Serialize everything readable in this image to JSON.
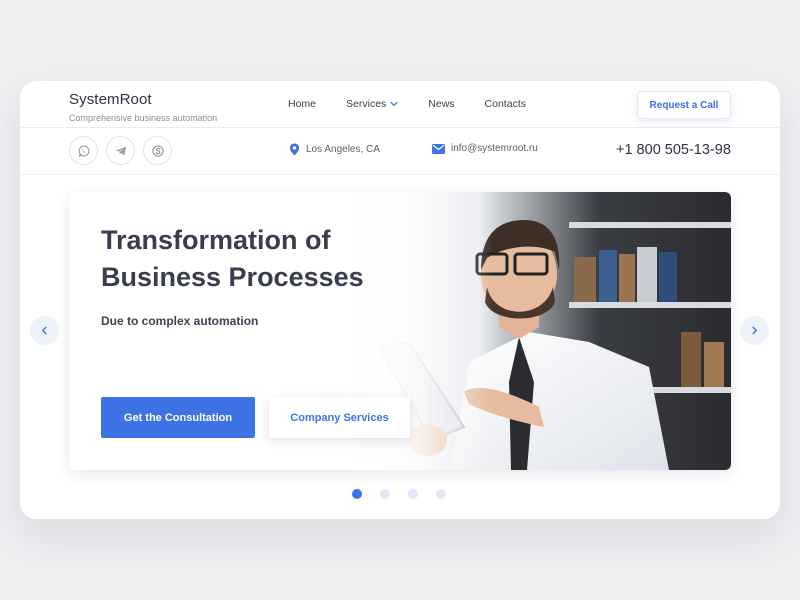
{
  "brand": {
    "name": "SystemRoot",
    "tagline": "Comprehensive business automation"
  },
  "nav": {
    "items": [
      "Home",
      "Services",
      "News",
      "Contacts"
    ]
  },
  "header": {
    "cta_label": "Request a Call"
  },
  "social": {
    "icons": [
      "whatsapp-icon",
      "telegram-icon",
      "skype-icon"
    ]
  },
  "contact": {
    "location": "Los Angeles, CA",
    "email": "info@systemroot.ru",
    "phone": "+1 800 505-13-98"
  },
  "hero": {
    "title": "Transformation of Business Processes",
    "subtitle": "Due to complex automation",
    "primary_button": "Get the Consultation",
    "secondary_button": "Company Services"
  },
  "slider": {
    "total": 4,
    "active": 1
  },
  "colors": {
    "accent": "#3e73e6",
    "text": "#2f3242",
    "background": "#efeff2"
  }
}
